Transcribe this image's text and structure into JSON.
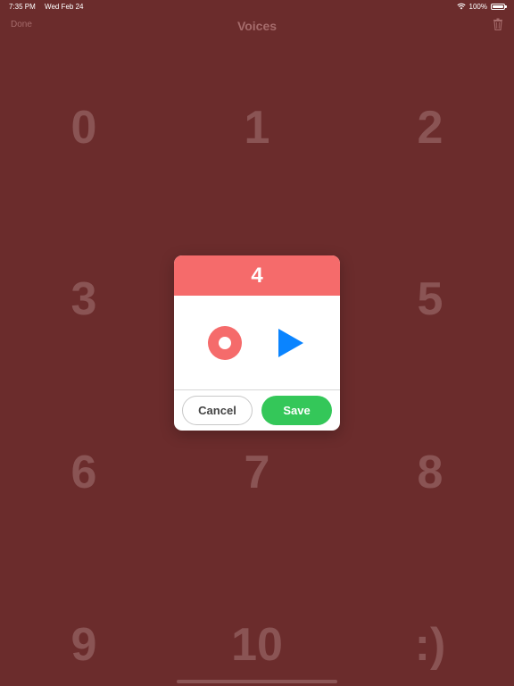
{
  "status_bar": {
    "time": "7:35 PM",
    "date": "Wed Feb 24",
    "battery": "100%",
    "battery_level": 1.0
  },
  "nav": {
    "done_label": "Done",
    "title": "Voices",
    "trash_icon": "trash-icon"
  },
  "grid": {
    "digits": [
      "0",
      "1",
      "2",
      "3",
      "4",
      "5",
      "6",
      "7",
      "8",
      "9",
      "10",
      ":)"
    ]
  },
  "dialog": {
    "title": "4",
    "record_icon": "record-icon",
    "play_icon": "play-icon",
    "cancel_label": "Cancel",
    "save_label": "Save"
  },
  "colors": {
    "background": "#6b2c2c",
    "accent_red": "#f56b6b",
    "play_blue": "#0a84ff",
    "save_green": "#34c759"
  }
}
